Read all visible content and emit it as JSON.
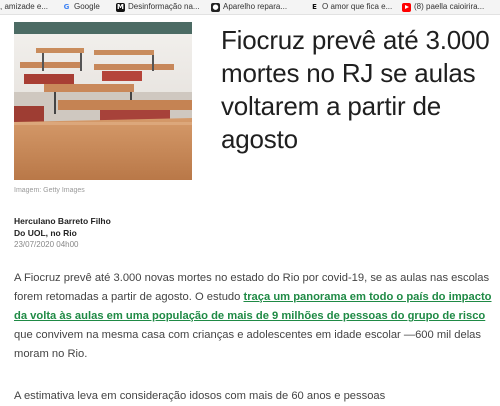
{
  "bookmarks": [
    {
      "label": ", amizade e...",
      "icon": "none"
    },
    {
      "label": "Google",
      "icon": "google-icon"
    },
    {
      "label": "Desinformação na...",
      "icon": "m-icon"
    },
    {
      "label": "Aparelho repara...",
      "icon": "github-icon"
    },
    {
      "label": "O amor que fica e...",
      "icon": "e-icon"
    },
    {
      "label": "(8) paella caioirira...",
      "icon": "youtube-icon"
    }
  ],
  "article": {
    "image_caption": "Imagem: Getty Images",
    "headline": "Fiocruz prevê até 3.000 mortes no RJ se aulas voltarem a partir de agosto",
    "author": "Herculano Barreto Filho",
    "location": "Do UOL, no Rio",
    "date": "23/07/2020  04h00",
    "para1_before": "A Fiocruz prevê até 3.000 novas mortes no estado do Rio por covid-19, se as aulas nas escolas forem retomadas a partir de agosto. O estudo ",
    "para1_link": "traça um panorama em todo o país do impacto da volta às aulas em uma população de mais de 9 milhões de pessoas do grupo de risco",
    "para1_after": " que convivem na mesma casa com crianças e adolescentes em idade escolar —600 mil delas moram no Rio.",
    "para2": "A estimativa leva em consideração idosos com mais de 60 anos e pessoas"
  }
}
